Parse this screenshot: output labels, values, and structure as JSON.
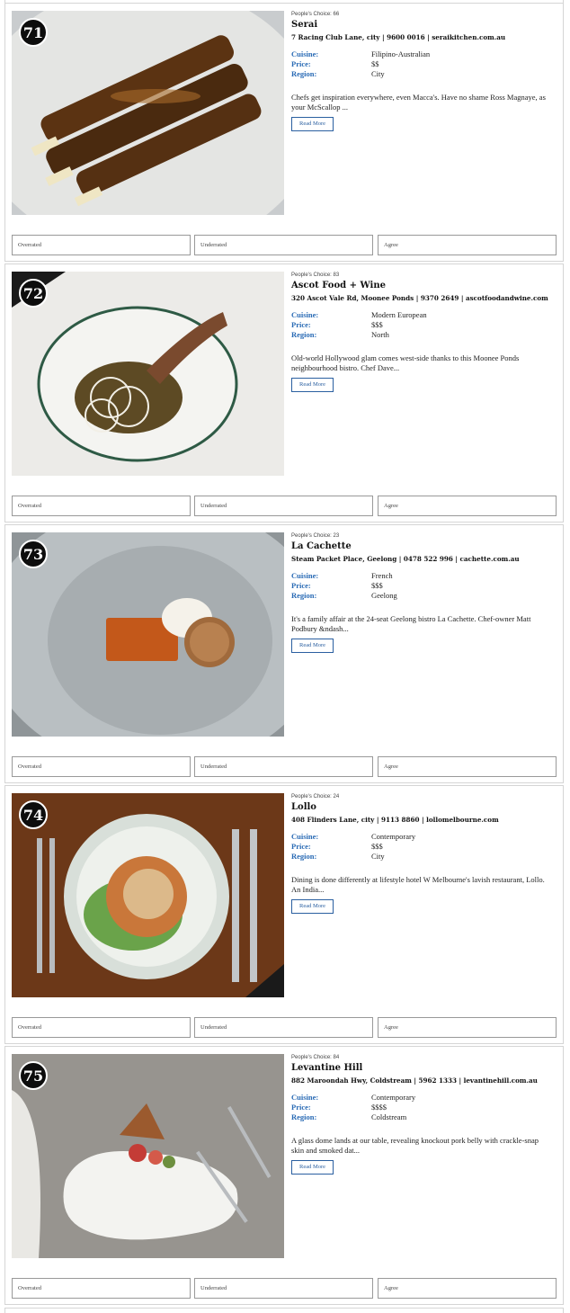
{
  "list": {
    "attr_labels": {
      "cuisine": "Cuisine:",
      "price": "Price:",
      "region": "Region:"
    },
    "read_more_label": "Read More",
    "vote_labels": {
      "overrated": "Overrated",
      "underrated": "Underrated",
      "agree": "Agree"
    },
    "items": [
      {
        "rank": "71",
        "peoples_choice": "People's Choice: 66",
        "name": "Serai",
        "address": "7 Racing Club Lane, city | 9600 0016 | seraikitchen.com.au",
        "cuisine": "Filipino-Australian",
        "price": "$$",
        "region": "City",
        "description": "Chefs get inspiration everywhere, even Macca's. Have no shame Ross Magnaye, as your McScallop ..."
      },
      {
        "rank": "72",
        "peoples_choice": "People's Choice: 83",
        "name": "Ascot Food + Wine",
        "address": "320 Ascot Vale Rd, Moonee Ponds | 9370 2649 | ascotfoodandwine.com",
        "cuisine": "Modern European",
        "price": "$$$",
        "region": "North",
        "description": "Old-world Hollywood glam comes west-side thanks to this Moonee Ponds neighbourhood bistro. Chef Dave..."
      },
      {
        "rank": "73",
        "peoples_choice": "People's Choice: 23",
        "name": "La Cachette",
        "address": "Steam Packet Place, Geelong | 0478 522 996 | cachette.com.au",
        "cuisine": "French",
        "price": "$$$",
        "region": "Geelong",
        "description": "It's a family affair at the 24-seat Geelong bistro La Cachette. Chef-owner Matt Podbury &ndash..."
      },
      {
        "rank": "74",
        "peoples_choice": "People's Choice: 24",
        "name": "Lollo",
        "address": "408 Flinders Lane, city | 9113 8860 | lollomelbourne.com",
        "cuisine": "Contemporary",
        "price": "$$$",
        "region": "City",
        "description": "Dining is done differently at lifestyle hotel W Melbourne's lavish restaurant, Lollo. An India..."
      },
      {
        "rank": "75",
        "peoples_choice": "People's Choice: 84",
        "name": "Levantine Hill",
        "address": "882 Maroondah Hwy, Coldstream | 5962 1333 | levantinehill.com.au",
        "cuisine": "Contemporary",
        "price": "$$$$",
        "region": "Coldstream",
        "description": "A glass dome lands at our table, revealing knockout pork belly with crackle-snap skin and smoked dat..."
      }
    ]
  },
  "colors": {
    "label_blue": "#2a6bb5",
    "button_blue": "#2a5fa0",
    "border": "#d5d5d5"
  }
}
